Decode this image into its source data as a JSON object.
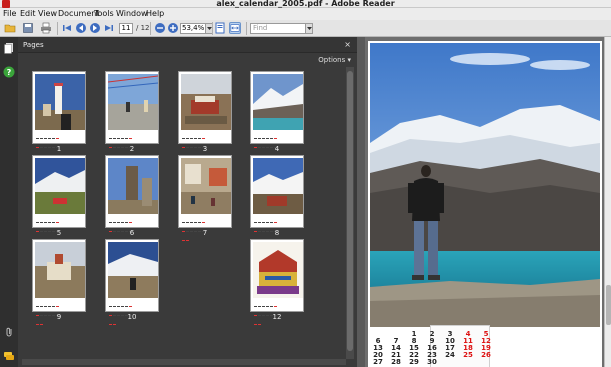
{
  "window": {
    "title": "alex_calendar_2005.pdf - Adobe Reader"
  },
  "menu": [
    "File",
    "Edit",
    "View",
    "Document",
    "Tools",
    "Window",
    "Help"
  ],
  "toolbar": {
    "current_page": "11",
    "page_count": "/ 12",
    "zoom": "53,4%",
    "find_placeholder": "Find"
  },
  "icons": {
    "open": "folder-open-icon",
    "save": "save-icon",
    "print": "print-icon",
    "first": "first-page-icon",
    "prev": "previous-page-icon",
    "next": "next-page-icon",
    "last": "last-page-icon",
    "zoom_out": "zoom-out-icon",
    "zoom_in": "zoom-in-icon",
    "fit_page": "fit-page-icon",
    "fit_width": "fit-width-icon",
    "pages": "pages-icon",
    "help": "help-icon",
    "attachments": "attachment-icon",
    "comments": "comments-icon"
  },
  "pages_panel": {
    "title": "Pages",
    "close": "×",
    "options": "Options ▾",
    "thumbnails": [
      {
        "label": "1"
      },
      {
        "label": "2"
      },
      {
        "label": "3"
      },
      {
        "label": "4"
      },
      {
        "label": "5"
      },
      {
        "label": "6"
      },
      {
        "label": "7"
      },
      {
        "label": "8"
      },
      {
        "label": "9"
      },
      {
        "label": "10"
      },
      {
        "label": "12"
      }
    ]
  },
  "document": {
    "calendar": {
      "rows": [
        [
          "",
          "",
          "1",
          "2",
          "3",
          "4",
          "5"
        ],
        [
          "6",
          "7",
          "8",
          "9",
          "10",
          "11",
          "12"
        ],
        [
          "13",
          "14",
          "15",
          "16",
          "17",
          "18",
          "19"
        ],
        [
          "20",
          "21",
          "22",
          "23",
          "24",
          "25",
          "26"
        ],
        [
          "27",
          "28",
          "29",
          "30",
          "",
          "",
          ""
        ]
      ],
      "red_columns": [
        5,
        6
      ]
    }
  },
  "colors": {
    "accent_red": "#d11111",
    "panel_bg": "#3a3a3a",
    "nav_bg": "#2f2f2f"
  }
}
